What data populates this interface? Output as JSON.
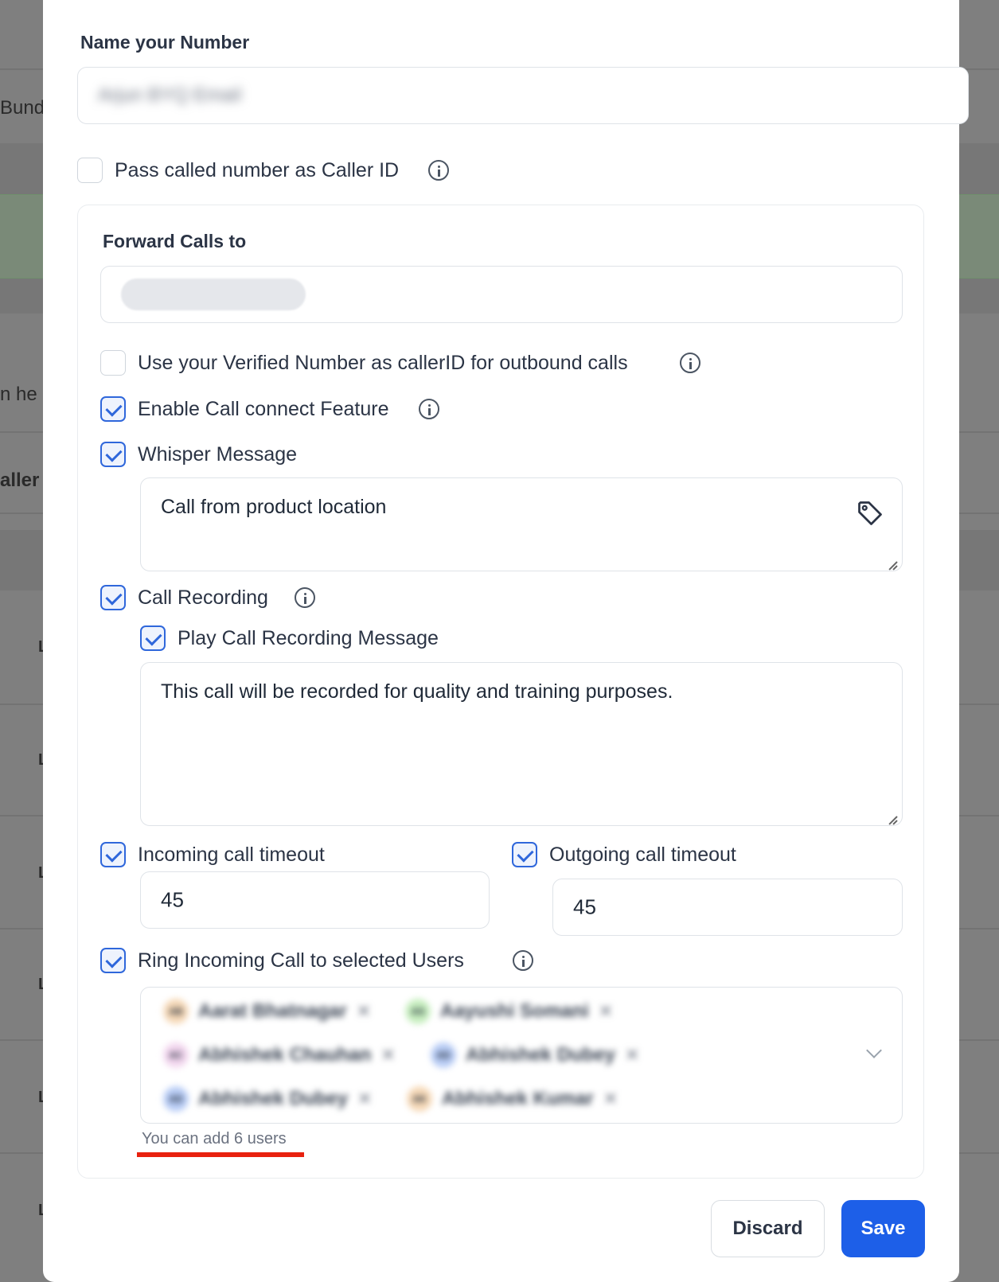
{
  "background": {
    "fragments": [
      "Bundl",
      "n he",
      "aller"
    ],
    "row_letters": [
      "L",
      "L",
      "L",
      "L",
      "L",
      "L"
    ]
  },
  "modal": {
    "name_label": "Name your Number",
    "name_value": "Arjun BYQ Email",
    "pass_caller_id_label": "Pass called number as Caller ID",
    "forward_label": "Forward Calls to",
    "verified_label": "Use your Verified Number as callerID for outbound calls",
    "call_connect_label": "Enable Call connect Feature",
    "whisper_label": "Whisper Message",
    "whisper_value": "Call from product location",
    "recording_label": "Call Recording",
    "play_recording_label": "Play Call Recording Message",
    "recording_message": "This call will be recorded for quality and training purposes.",
    "incoming_timeout_label": "Incoming call timeout",
    "incoming_timeout_value": "45",
    "outgoing_timeout_label": "Outgoing call timeout",
    "outgoing_timeout_value": "45",
    "ring_users_label": "Ring Incoming Call to selected Users",
    "users": [
      {
        "initials": "AB",
        "name": "Aarat Bhatnagar",
        "color": "#f6d9b8"
      },
      {
        "initials": "AS",
        "name": "Aayushi Somani",
        "color": "#c8efc0"
      },
      {
        "initials": "AC",
        "name": "Abhishek Chauhan",
        "color": "#f3d7ef"
      },
      {
        "initials": "AD",
        "name": "Abhishek Dubey",
        "color": "#b9cdf6"
      },
      {
        "initials": "AD",
        "name": "Abhishek Dubey",
        "color": "#b9cdf6"
      },
      {
        "initials": "AK",
        "name": "Abhishek Kumar",
        "color": "#f6d9b8"
      }
    ],
    "users_helper": "You can add 6 users",
    "discard_label": "Discard",
    "save_label": "Save",
    "accent_color": "#1d5fe8",
    "highlight_color": "#e8210f"
  }
}
